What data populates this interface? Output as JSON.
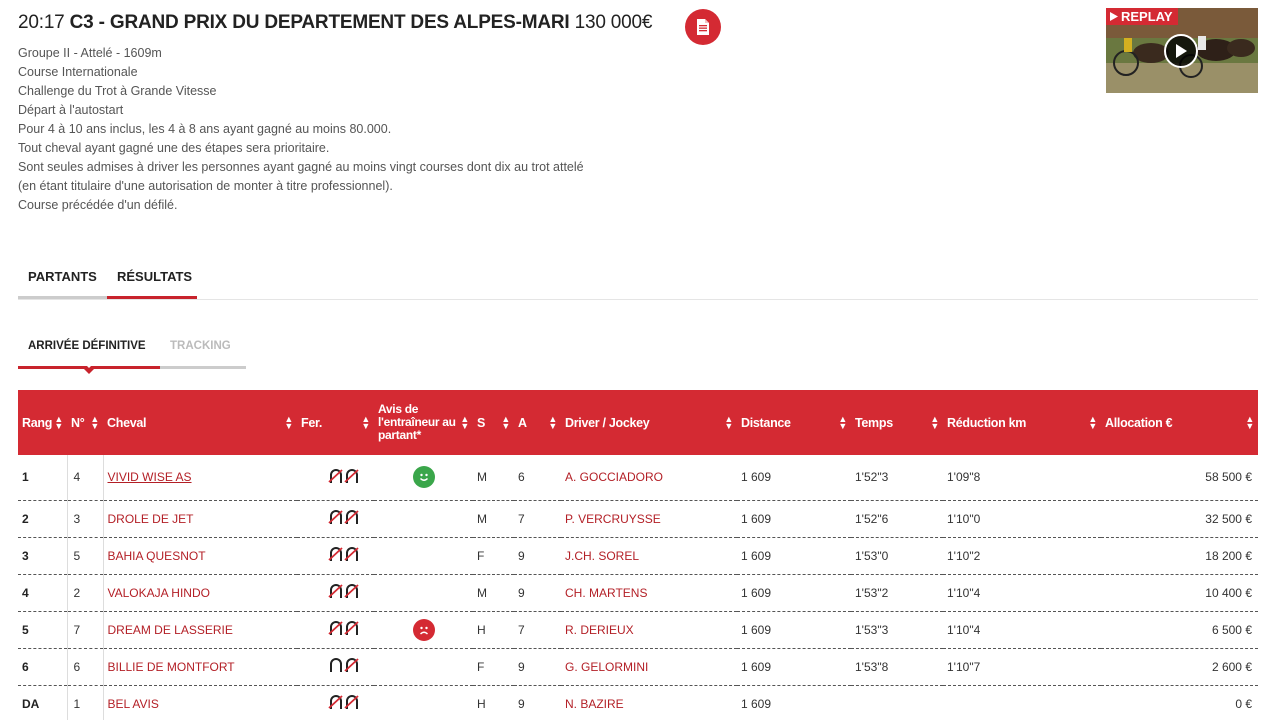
{
  "race": {
    "time": "20:17",
    "code": "C3",
    "separator": "-",
    "name": "GRAND PRIX DU DEPARTEMENT DES ALPES-MARI",
    "prize": "130 000€",
    "details": [
      "Groupe II - Attelé - 1609m",
      "Course Internationale",
      "Challenge du Trot à Grande Vitesse",
      "Départ à l'autostart",
      "Pour 4 à 10 ans inclus, les 4 à 8 ans ayant gagné au moins 80.000.",
      "Tout cheval ayant gagné une des étapes sera prioritaire.",
      "Sont seules admises à driver les personnes ayant gagné au moins vingt courses dont dix au trot attelé",
      "(en étant titulaire d'une autorisation de monter à titre professionnel).",
      "Course précédée d'un défilé."
    ]
  },
  "replay": {
    "label": "REPLAY"
  },
  "tabs": {
    "partants": "PARTANTS",
    "resultats": "RÉSULTATS"
  },
  "subtabs": {
    "arrivee": "ARRIVÉE DÉFINITIVE",
    "tracking": "TRACKING"
  },
  "table": {
    "headers": {
      "rang": "Rang",
      "num": "N°",
      "cheval": "Cheval",
      "fer": "Fer.",
      "avis": "Avis de l'entraîneur au partant*",
      "s": "S",
      "a": "A",
      "driver": "Driver / Jockey",
      "distance": "Distance",
      "temps": "Temps",
      "reduction": "Réduction km",
      "allocation": "Allocation €"
    },
    "rows": [
      {
        "rang": "1",
        "num": "4",
        "cheval": "VIVID WISE AS",
        "s": "M",
        "a": "6",
        "driver": "A. GOCCIADORO",
        "distance": "1 609",
        "temps": "1'52\"3",
        "reduction": "1'09\"8",
        "allocation": "58 500 €"
      },
      {
        "rang": "2",
        "num": "3",
        "cheval": "DROLE DE JET",
        "s": "M",
        "a": "7",
        "driver": "P. VERCRUYSSE",
        "distance": "1 609",
        "temps": "1'52\"6",
        "reduction": "1'10\"0",
        "allocation": "32 500 €"
      },
      {
        "rang": "3",
        "num": "5",
        "cheval": "BAHIA QUESNOT",
        "s": "F",
        "a": "9",
        "driver": "J.CH. SOREL",
        "distance": "1 609",
        "temps": "1'53\"0",
        "reduction": "1'10\"2",
        "allocation": "18 200 €"
      },
      {
        "rang": "4",
        "num": "2",
        "cheval": "VALOKAJA HINDO",
        "s": "M",
        "a": "9",
        "driver": "CH. MARTENS",
        "distance": "1 609",
        "temps": "1'53\"2",
        "reduction": "1'10\"4",
        "allocation": "10 400 €"
      },
      {
        "rang": "5",
        "num": "7",
        "cheval": "DREAM DE LASSERIE",
        "s": "H",
        "a": "7",
        "driver": "R. DERIEUX",
        "distance": "1 609",
        "temps": "1'53\"3",
        "reduction": "1'10\"4",
        "allocation": "6 500 €"
      },
      {
        "rang": "6",
        "num": "6",
        "cheval": "BILLIE DE MONTFORT",
        "s": "F",
        "a": "9",
        "driver": "G. GELORMINI",
        "distance": "1 609",
        "temps": "1'53\"8",
        "reduction": "1'10\"7",
        "allocation": "2 600 €"
      },
      {
        "rang": "DA",
        "num": "1",
        "cheval": "BEL AVIS",
        "s": "H",
        "a": "9",
        "driver": "N. BAZIRE",
        "distance": "1 609",
        "temps": "",
        "reduction": "",
        "allocation": "0 €"
      }
    ]
  },
  "colors": {
    "brand_red": "#d42a33",
    "link_red": "#b31f26",
    "good": "#3aa64a",
    "bad": "#d42a33"
  },
  "icons": {
    "pdf": "document-icon",
    "play": "play-icon",
    "shoe": "horseshoe-icon",
    "good": "smiley-happy-icon",
    "bad": "smiley-sad-icon"
  }
}
